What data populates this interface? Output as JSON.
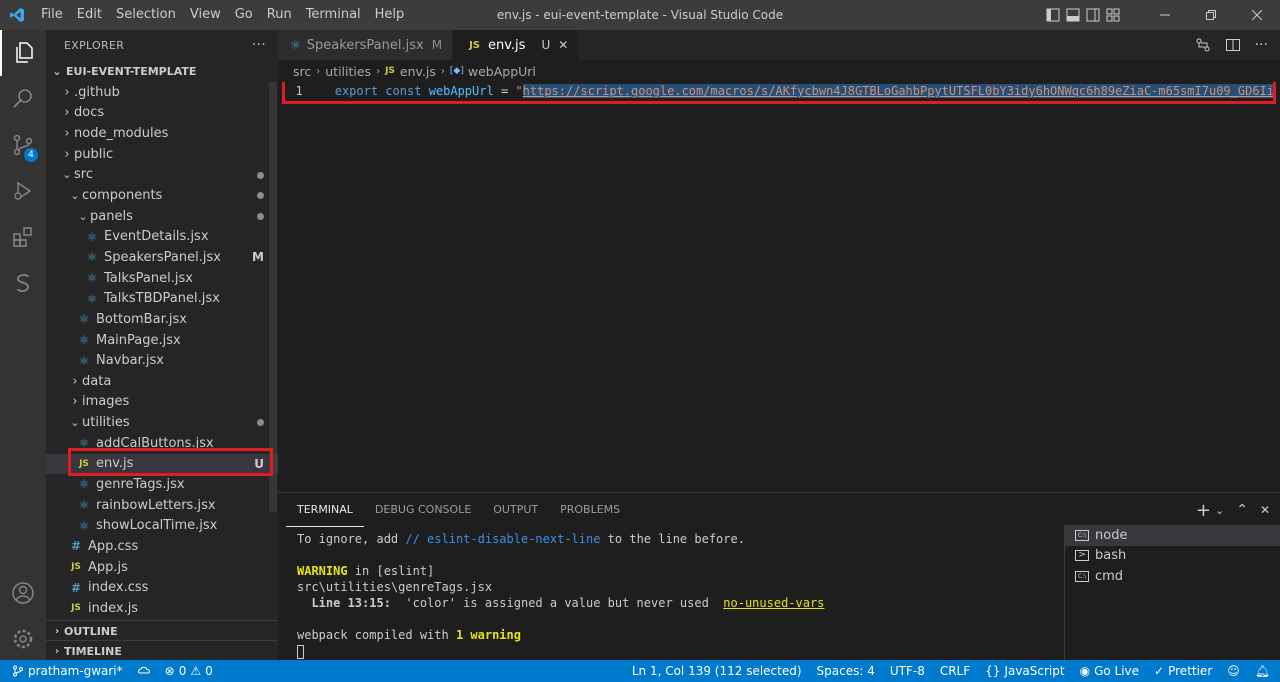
{
  "window": {
    "title": "env.js - eui-event-template - Visual Studio Code",
    "menus": [
      "File",
      "Edit",
      "Selection",
      "View",
      "Go",
      "Run",
      "Terminal",
      "Help"
    ]
  },
  "sidebar": {
    "header": "EXPLORER",
    "more_icon": "···",
    "project": "EUI-EVENT-TEMPLATE",
    "items": [
      {
        "label": ".github",
        "type": "folder",
        "open": false,
        "indent": 0
      },
      {
        "label": "docs",
        "type": "folder",
        "open": false,
        "indent": 0
      },
      {
        "label": "node_modules",
        "type": "folder",
        "open": false,
        "indent": 0
      },
      {
        "label": "public",
        "type": "folder",
        "open": false,
        "indent": 0
      },
      {
        "label": "src",
        "type": "folder",
        "open": true,
        "indent": 0,
        "dot": true
      },
      {
        "label": "components",
        "type": "folder",
        "open": true,
        "indent": 1,
        "dot": true
      },
      {
        "label": "panels",
        "type": "folder",
        "open": true,
        "indent": 2,
        "dot": true
      },
      {
        "label": "EventDetails.jsx",
        "type": "react",
        "indent": 3
      },
      {
        "label": "SpeakersPanel.jsx",
        "type": "react",
        "indent": 3,
        "status": "M"
      },
      {
        "label": "TalksPanel.jsx",
        "type": "react",
        "indent": 3
      },
      {
        "label": "TalksTBDPanel.jsx",
        "type": "react",
        "indent": 3
      },
      {
        "label": "BottomBar.jsx",
        "type": "react",
        "indent": 2
      },
      {
        "label": "MainPage.jsx",
        "type": "react",
        "indent": 2
      },
      {
        "label": "Navbar.jsx",
        "type": "react",
        "indent": 2
      },
      {
        "label": "data",
        "type": "folder",
        "open": false,
        "indent": 1
      },
      {
        "label": "images",
        "type": "folder",
        "open": false,
        "indent": 1
      },
      {
        "label": "utilities",
        "type": "folder",
        "open": true,
        "indent": 1,
        "dot": true
      },
      {
        "label": "addCalButtons.jsx",
        "type": "react",
        "indent": 2
      },
      {
        "label": "env.js",
        "type": "js",
        "indent": 2,
        "status": "U",
        "selected": true
      },
      {
        "label": "genreTags.jsx",
        "type": "react",
        "indent": 2
      },
      {
        "label": "rainbowLetters.jsx",
        "type": "react",
        "indent": 2
      },
      {
        "label": "showLocalTime.jsx",
        "type": "react",
        "indent": 2
      },
      {
        "label": "App.css",
        "type": "css",
        "indent": 1
      },
      {
        "label": "App.js",
        "type": "js",
        "indent": 1
      },
      {
        "label": "index.css",
        "type": "css",
        "indent": 1
      },
      {
        "label": "index.js",
        "type": "js",
        "indent": 1
      }
    ],
    "outline": "OUTLINE",
    "timeline": "TIMELINE"
  },
  "activity": {
    "scm_badge": "4"
  },
  "tabs": [
    {
      "label": "SpeakersPanel.jsx",
      "status": "M",
      "icon": "react",
      "active": false
    },
    {
      "label": "env.js",
      "status": "U",
      "icon": "js",
      "active": true
    }
  ],
  "close_icon": "✕",
  "breadcrumb": {
    "parts": [
      "src",
      "utilities",
      "env.js",
      "webAppUrl"
    ],
    "js_glyph": "JS",
    "var_glyph": "[◆]"
  },
  "code": {
    "line_number": "1",
    "export": "export",
    "const": "const",
    "name": "webAppUrl",
    "eq": " = ",
    "quote": "\"",
    "url": "https://script.google.com/macros/s/AKfycbwn4J8GTBLoGahbPpytUTSFL0bY3idy6hONWqc6h89eZiaC-m65smI7u09_GD6Ii"
  },
  "panel": {
    "tabs": [
      "TERMINAL",
      "DEBUG CONSOLE",
      "OUTPUT",
      "PROBLEMS"
    ],
    "terminal": {
      "line1_a": "To ignore, add ",
      "line1_b": "// eslint-disable-next-line",
      "line1_c": " to the line before.",
      "warning": "WARNING",
      "warning_rest": " in [eslint]",
      "file": "src\\utilities\\genreTags.jsx",
      "lineinfo": "  Line 13:15:",
      "message": "  'color' is assigned a value but never used  ",
      "rule": "no-unused-vars",
      "compiled": "webpack compiled with ",
      "count": "1 warning"
    },
    "terminals": [
      "node",
      "bash",
      "cmd"
    ],
    "actions": {
      "add": "+",
      "split": "⌄",
      "up": "⌃",
      "close": "✕"
    }
  },
  "status": {
    "branch": "pratham-gwari*",
    "errors": "0",
    "warnings": "0",
    "position": "Ln 1, Col 139 (112 selected)",
    "spaces": "Spaces: 4",
    "encoding": "UTF-8",
    "eol": "CRLF",
    "language": "JavaScript",
    "golive": "Go Live",
    "prettier": "Prettier"
  },
  "colors": {
    "accent": "#007acc",
    "highlight": "#e01b24"
  }
}
